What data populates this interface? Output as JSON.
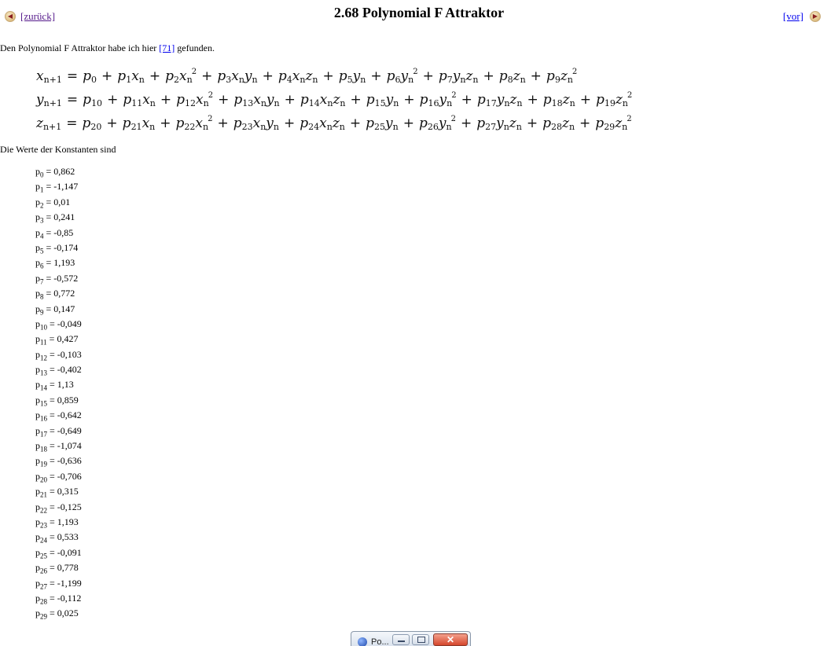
{
  "nav": {
    "prev_label": "[zurück]",
    "next_label": "[vor]",
    "prev_icon": "left-arrow-circle-icon",
    "next_icon": "right-arrow-circle-icon"
  },
  "page": {
    "title": "2.68 Polynomial F Attraktor",
    "intro_before": "Den Polynomial F Attraktor habe ich hier ",
    "intro_link": "[71]",
    "intro_after": " gefunden.",
    "constants_intro": "Die Werte der Konstanten sind"
  },
  "equations": [
    {
      "var": "x",
      "start": 0
    },
    {
      "var": "y",
      "start": 10
    },
    {
      "var": "z",
      "start": 20
    }
  ],
  "constants": [
    {
      "name": "p",
      "index": "0",
      "value": "0,862"
    },
    {
      "name": "p",
      "index": "1",
      "value": "-1,147"
    },
    {
      "name": "p",
      "index": "2",
      "value": "0,01"
    },
    {
      "name": "p",
      "index": "3",
      "value": "0,241"
    },
    {
      "name": "p",
      "index": "4",
      "value": "-0,85"
    },
    {
      "name": "p",
      "index": "5",
      "value": "-0,174"
    },
    {
      "name": "p",
      "index": "6",
      "value": "1,193"
    },
    {
      "name": "p",
      "index": "7",
      "value": "-0,572"
    },
    {
      "name": "p",
      "index": "8",
      "value": "0,772"
    },
    {
      "name": "p",
      "index": "9",
      "value": "0,147"
    },
    {
      "name": "p",
      "index": "10",
      "value": "-0,049"
    },
    {
      "name": "p",
      "index": "11",
      "value": "0,427"
    },
    {
      "name": "p",
      "index": "12",
      "value": "-0,103"
    },
    {
      "name": "p",
      "index": "13",
      "value": "-0,402"
    },
    {
      "name": "p",
      "index": "14",
      "value": "1,13"
    },
    {
      "name": "p",
      "index": "15",
      "value": "0,859"
    },
    {
      "name": "p",
      "index": "16",
      "value": "-0,642"
    },
    {
      "name": "p",
      "index": "17",
      "value": "-0,649"
    },
    {
      "name": "p",
      "index": "18",
      "value": "-1,074"
    },
    {
      "name": "p",
      "index": "19",
      "value": "-0,636"
    },
    {
      "name": "p",
      "index": "20",
      "value": "-0,706"
    },
    {
      "name": "p",
      "index": "21",
      "value": "0,315"
    },
    {
      "name": "p",
      "index": "22",
      "value": "-0,125"
    },
    {
      "name": "p",
      "index": "23",
      "value": "1,193"
    },
    {
      "name": "p",
      "index": "24",
      "value": "0,533"
    },
    {
      "name": "p",
      "index": "25",
      "value": "-0,091"
    },
    {
      "name": "p",
      "index": "26",
      "value": "0,778"
    },
    {
      "name": "p",
      "index": "27",
      "value": "-1,199"
    },
    {
      "name": "p",
      "index": "28",
      "value": "-0,112"
    },
    {
      "name": "p",
      "index": "29",
      "value": "0,025"
    }
  ],
  "taskbar": {
    "app_label": "Po...",
    "app_icon": "browser-globe-icon",
    "minimize_icon": "minimize-icon",
    "maximize_icon": "maximize-icon",
    "close_icon": "close-icon"
  }
}
